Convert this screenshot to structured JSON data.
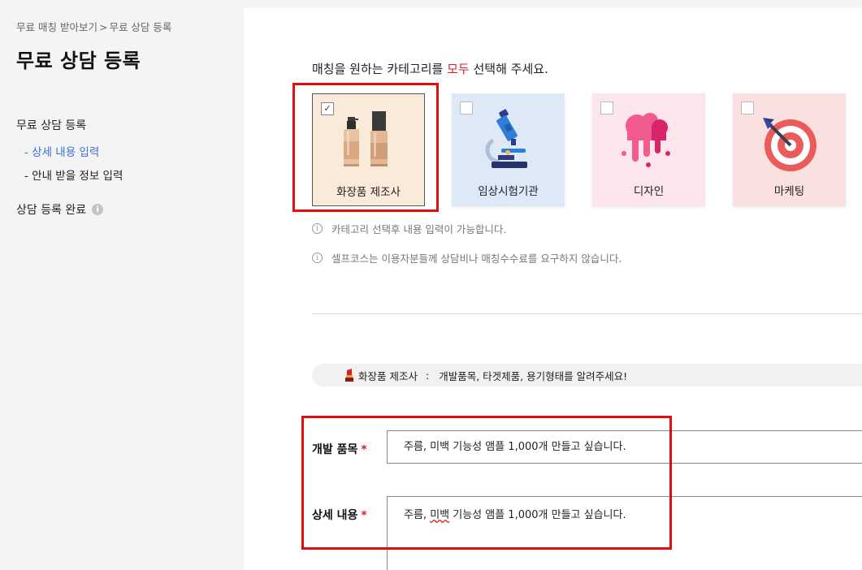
{
  "breadcrumb": {
    "items": [
      "무료 매칭 받아보기",
      "무료 상담 등록"
    ],
    "separator": ">"
  },
  "page_title": "무료 상담 등록",
  "sidebar": {
    "main_item": "무료 상담 등록",
    "sub_items": [
      {
        "label": "- 상세 내용 입력",
        "active": true
      },
      {
        "label": "- 안내 받을 정보 입력",
        "active": false
      }
    ],
    "complete_item": "상담 등록 완료",
    "info_icon_glyph": "i"
  },
  "instruction": {
    "before": "매칭을 원하는 카테고리를 ",
    "highlight": "모두",
    "after": " 선택해 주세요."
  },
  "categories": [
    {
      "label": "화장품 제조사",
      "icon": "cosmetics-bottles-icon",
      "checked": true,
      "bg": "#f9ead9"
    },
    {
      "label": "임상시험기관",
      "icon": "microscope-icon",
      "checked": false,
      "bg": "#dee9f8"
    },
    {
      "label": "디자인",
      "icon": "paint-splash-icon",
      "checked": false,
      "bg": "#fde5ec"
    },
    {
      "label": "마케팅",
      "icon": "target-dart-icon",
      "checked": false,
      "bg": "#fbe0e0"
    }
  ],
  "checkbox_glyph": "✓",
  "notes": [
    "카테고리 선택후 내용 입력이 가능합니다.",
    "셀프코스는 이용자분들께 상담비나 매칭수수료를 요구하지 않습니다."
  ],
  "note_icon_glyph": "i",
  "guide": {
    "category": "화장품 제조사",
    "separator": ":",
    "text": "개발품목, 타겟제품, 용기형태를 알려주세요!"
  },
  "fields": {
    "product": {
      "label": "개발 품목",
      "required_mark": "*",
      "value": "주름, 미백 기능성 앰플 1,000개 만들고 싶습니다."
    },
    "details": {
      "label": "상세 내용",
      "required_mark": "*",
      "value_part1": "주름, ",
      "value_misspelled": "미백",
      "value_part2": " 기능성 앰플 1,000개 만들고 싶습니다."
    }
  },
  "colors": {
    "accent_red": "#d4212e",
    "active_link": "#3b6fd8",
    "annotation_red": "#e20d0d"
  }
}
